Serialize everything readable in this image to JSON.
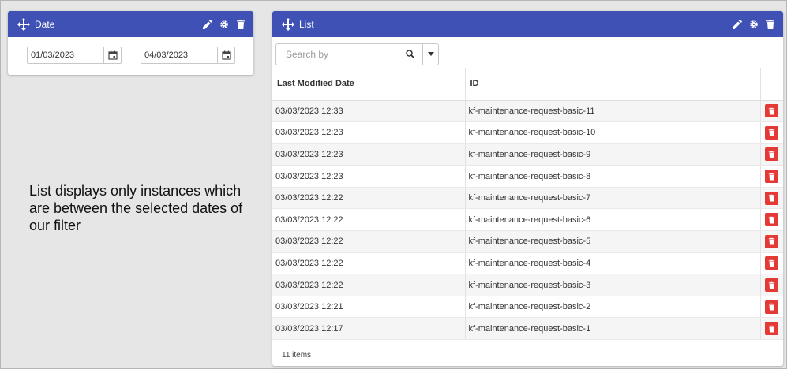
{
  "date_widget": {
    "title": "Date",
    "start_date": "01/03/2023",
    "end_date": "04/03/2023"
  },
  "caption": "List displays only instances which are between the selected dates of our filter",
  "list_widget": {
    "title": "List",
    "search_placeholder": "Search by",
    "columns": [
      "Last Modified Date",
      "ID"
    ],
    "rows": [
      {
        "date": "03/03/2023 12:33",
        "id": "kf-maintenance-request-basic-11"
      },
      {
        "date": "03/03/2023 12:23",
        "id": "kf-maintenance-request-basic-10"
      },
      {
        "date": "03/03/2023 12:23",
        "id": "kf-maintenance-request-basic-9"
      },
      {
        "date": "03/03/2023 12:23",
        "id": "kf-maintenance-request-basic-8"
      },
      {
        "date": "03/03/2023 12:22",
        "id": "kf-maintenance-request-basic-7"
      },
      {
        "date": "03/03/2023 12:22",
        "id": "kf-maintenance-request-basic-6"
      },
      {
        "date": "03/03/2023 12:22",
        "id": "kf-maintenance-request-basic-5"
      },
      {
        "date": "03/03/2023 12:22",
        "id": "kf-maintenance-request-basic-4"
      },
      {
        "date": "03/03/2023 12:22",
        "id": "kf-maintenance-request-basic-3"
      },
      {
        "date": "03/03/2023 12:21",
        "id": "kf-maintenance-request-basic-2"
      },
      {
        "date": "03/03/2023 12:17",
        "id": "kf-maintenance-request-basic-1"
      }
    ],
    "footer": "11 items"
  },
  "colors": {
    "header": "#3f51b5",
    "delete": "#e53935"
  },
  "icons": [
    "move-icon",
    "edit-icon",
    "settings-icon",
    "trash-icon",
    "calendar-icon",
    "search-icon",
    "caret-down-icon"
  ]
}
